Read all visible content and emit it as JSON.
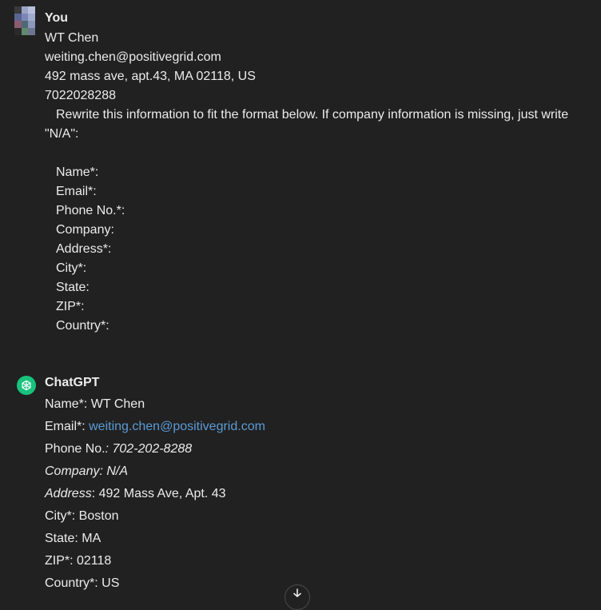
{
  "user_message": {
    "author": "You",
    "lines": [
      "WT Chen",
      "weiting.chen@positivegrid.com",
      "492 mass ave, apt.43, MA 02118, US",
      "7022028288"
    ],
    "instruction": "Rewrite this information to fit the format below. If company information is missing, just write \"N/A\":",
    "fields": [
      "Name*:",
      "Email*:",
      "Phone No.*:",
      "Company:",
      "Address*:",
      "City*:",
      "State:",
      "ZIP*:",
      "Country*:"
    ]
  },
  "assistant_message": {
    "author": "ChatGPT",
    "name_label": "Name*:",
    "name_value": " WT Chen",
    "email_label": "Email*: ",
    "email_value": "weiting.chen@positivegrid.com",
    "phone_label": "Phone No.",
    "phone_value": ": 702-202-8288",
    "company": "Company: N/A",
    "address_label": "Address",
    "address_value": ": 492 Mass Ave, Apt. 43",
    "city": "City*: Boston",
    "state": "State: MA",
    "zip": "ZIP*: 02118",
    "country": "Country*: US"
  },
  "colors": {
    "background": "#212121",
    "text": "#ececec",
    "link": "#5b9bd5",
    "gpt_green": "#19c37d"
  },
  "icons": {
    "user_avatar": "pixel-avatar-icon",
    "assistant_avatar": "openai-logo-icon",
    "scroll_down": "chevron-down-icon"
  }
}
